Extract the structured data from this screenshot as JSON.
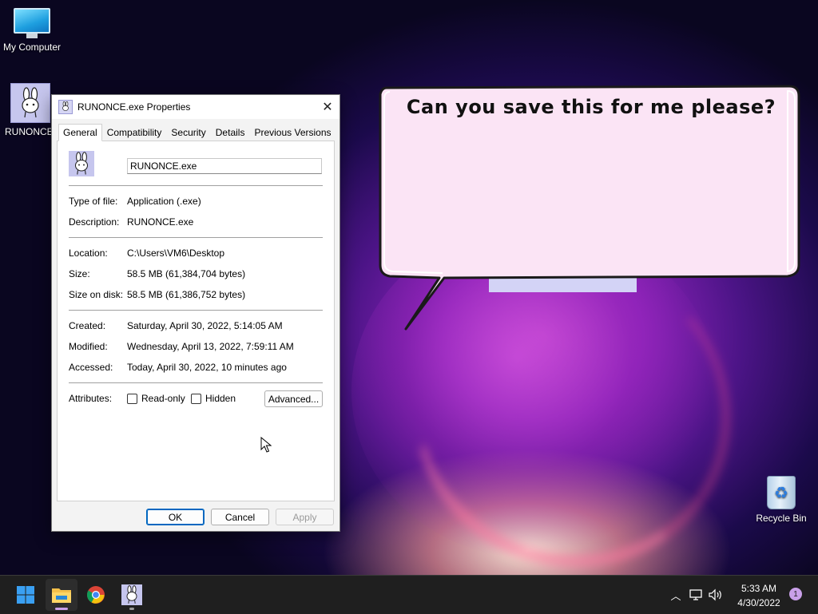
{
  "desktop": {
    "icons": [
      {
        "label": "My Computer"
      },
      {
        "label": "RUNONCE."
      },
      {
        "label": "Recycle Bin"
      }
    ]
  },
  "window": {
    "title": "RUNONCE.exe Properties",
    "tabs": [
      "General",
      "Compatibility",
      "Security",
      "Details",
      "Previous Versions"
    ],
    "active_tab": "General",
    "file_name": "RUNONCE.exe",
    "fields": {
      "type_label": "Type of file:",
      "type_value": "Application (.exe)",
      "desc_label": "Description:",
      "desc_value": "RUNONCE.exe",
      "location_label": "Location:",
      "location_value": "C:\\Users\\VM6\\Desktop",
      "size_label": "Size:",
      "size_value": "58.5 MB (61,384,704 bytes)",
      "sod_label": "Size on disk:",
      "sod_value": "58.5 MB (61,386,752 bytes)",
      "created_label": "Created:",
      "created_value": "Saturday, April 30, 2022, 5:14:05 AM",
      "modified_label": "Modified:",
      "modified_value": "Wednesday, April 13, 2022, 7:59:11 AM",
      "accessed_label": "Accessed:",
      "accessed_value": "Today, April 30, 2022, 10 minutes ago",
      "attributes_label": "Attributes:"
    },
    "attributes": {
      "readonly_label": "Read-only",
      "readonly_checked": false,
      "hidden_label": "Hidden",
      "hidden_checked": false,
      "advanced_label": "Advanced..."
    },
    "buttons": {
      "ok": "OK",
      "cancel": "Cancel",
      "apply": "Apply"
    }
  },
  "bubble": {
    "text": "Can you save this for me please?"
  },
  "taskbar": {
    "apps": [
      {
        "icon": "windows-start-icon"
      },
      {
        "icon": "file-explorer-icon"
      },
      {
        "icon": "chrome-icon"
      },
      {
        "icon": "runonce-app-icon"
      }
    ],
    "clock_time": "5:33 AM",
    "clock_date": "4/30/2022",
    "notification_count": "1"
  },
  "colors": {
    "accent": "#0067c0",
    "bubble_fill": "#fbe4f5",
    "taskbar": "#1f1f1f"
  }
}
